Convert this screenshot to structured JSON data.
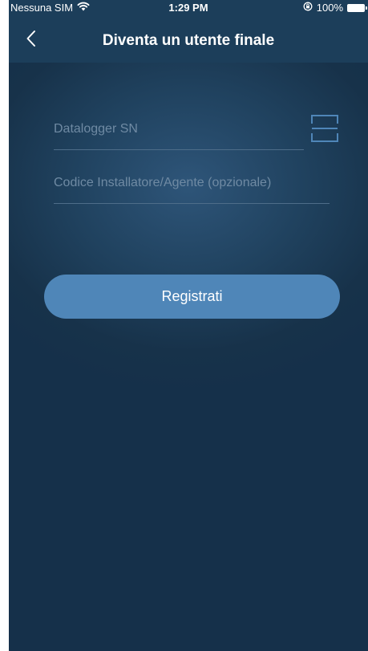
{
  "status_bar": {
    "carrier": "Nessuna SIM",
    "time": "1:29 PM",
    "battery": "100%"
  },
  "nav": {
    "title": "Diventa un utente finale"
  },
  "form": {
    "datalogger_placeholder": "Datalogger SN",
    "datalogger_value": "",
    "installer_placeholder": "Codice Installatore/Agente (opzionale)",
    "installer_value": ""
  },
  "actions": {
    "register_label": "Registrati"
  },
  "icons": {
    "back": "chevron-left-icon",
    "wifi": "wifi-icon",
    "rotation_lock": "rotation-lock-icon",
    "battery": "battery-icon",
    "scan": "scan-frame-icon"
  },
  "colors": {
    "nav_background": "#1c3e5a",
    "background": "#1a3a56",
    "button": "#4f86b8",
    "text": "#ffffff",
    "placeholder": "#6f8aa3"
  }
}
